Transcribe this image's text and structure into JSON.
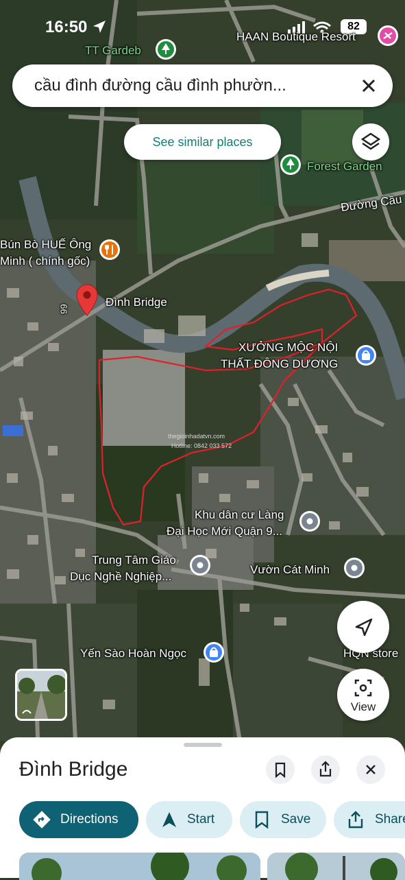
{
  "status": {
    "time": "16:50",
    "battery": "82"
  },
  "search": {
    "query": "cầu đình đường cầu đình phườn..."
  },
  "similar_label": "See similar places",
  "map_labels": {
    "tt_garden": "TT Gardeb",
    "haan": "HAAN Boutique Resort",
    "forest_garden": "Forest Garden",
    "duong_cau": "Đường Cầu",
    "bun_bo_1": "Bún Bò HUẾ Ông",
    "bun_bo_2": "Minh ( chính gốc)",
    "road_99": "99",
    "dinh_bridge": "Đình Bridge",
    "xuong_1": "XƯỞNG MỘC NỘI",
    "xuong_2": "THẤT ĐÔNG DƯƠNG",
    "watermark_1": "thegioinhadatvn.com",
    "watermark_2": "Hotline: 0842 033 572",
    "khu_1": "Khu dân cư Làng",
    "khu_2": "Đại Học Mới Quận 9...",
    "trung_tam_1": "Trung Tâm Giáo",
    "trung_tam_2": "Dục Nghề Nghiệp...",
    "vuon": "Vườn Cát Minh",
    "yen_sao": "Yến Sào Hoàn Ngọc",
    "hqn": "HQN store"
  },
  "view_label": "View",
  "sheet": {
    "title": "Đình Bridge",
    "directions": "Directions",
    "start": "Start",
    "save": "Save",
    "share": "Share"
  },
  "colors": {
    "accent": "#0f6273",
    "chip_bg": "#dbeef4",
    "pin": "#e53935",
    "boundary": "#e0202a"
  },
  "icons": [
    "location-arrow-icon",
    "signal-icon",
    "wifi-icon",
    "close-icon",
    "layers-icon",
    "tree-icon",
    "restaurant-icon",
    "map-pin-icon",
    "shop-icon",
    "place-icon",
    "navigation-icon",
    "street-view-icon",
    "bookmark-icon",
    "share-icon",
    "directions-icon",
    "start-icon"
  ]
}
